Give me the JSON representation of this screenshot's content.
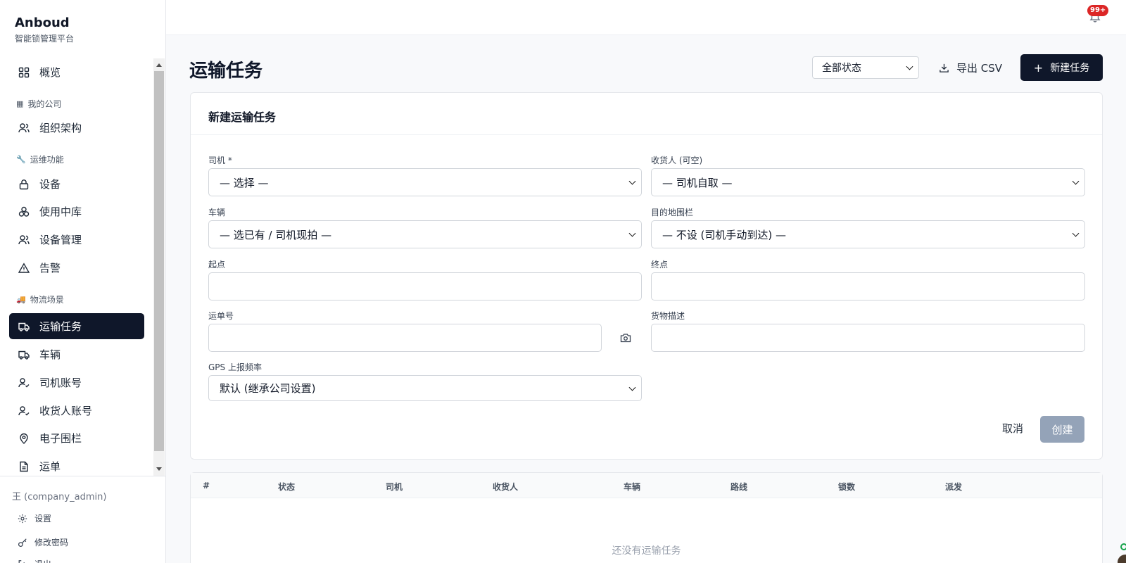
{
  "brand": {
    "name": "Anboud",
    "subtitle": "智能锁管理平台"
  },
  "sidebar": {
    "items": [
      {
        "label": "概览"
      },
      {
        "section": "我的公司"
      },
      {
        "label": "组织架构"
      },
      {
        "section": "运维功能"
      },
      {
        "label": "设备"
      },
      {
        "label": "使用中库"
      },
      {
        "label": "设备管理"
      },
      {
        "label": "告警"
      },
      {
        "section": "物流场景"
      },
      {
        "label": "运输任务"
      },
      {
        "label": "车辆"
      },
      {
        "label": "司机账号"
      },
      {
        "label": "收货人账号"
      },
      {
        "label": "电子围栏"
      },
      {
        "label": "运单"
      }
    ],
    "user": "王 (company_admin)",
    "settings": "设置",
    "change_password": "修改密码",
    "logout": "退出"
  },
  "topbar": {
    "notification_count": "99+"
  },
  "header": {
    "title": "运输任务",
    "status_filter": "全部状态",
    "export_label": "导出 CSV",
    "new_label": "新建任务"
  },
  "form": {
    "title": "新建运输任务",
    "driver": {
      "label": "司机 *",
      "value": "— 选择 —"
    },
    "consignee": {
      "label": "收货人 (可空)",
      "value": "— 司机自取 —"
    },
    "vehicle": {
      "label": "车辆",
      "value": "— 选已有 / 司机现拍 —"
    },
    "destination_fence": {
      "label": "目的地围栏",
      "value": "— 不设 (司机手动到达) —"
    },
    "origin": {
      "label": "起点",
      "value": ""
    },
    "terminal": {
      "label": "终点",
      "value": ""
    },
    "waybill": {
      "label": "运单号",
      "value": ""
    },
    "cargo": {
      "label": "货物描述",
      "value": ""
    },
    "gps": {
      "label": "GPS 上报频率",
      "value": "默认 (继承公司设置)"
    },
    "cancel": "取消",
    "create": "创建"
  },
  "table": {
    "columns": [
      "#",
      "状态",
      "司机",
      "收货人",
      "车辆",
      "路线",
      "锁数",
      "派发"
    ],
    "empty_text": "还没有运输任务"
  }
}
